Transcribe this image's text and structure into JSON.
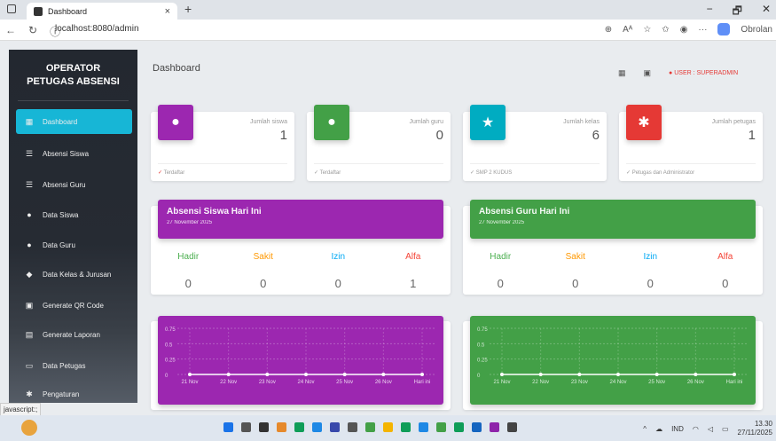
{
  "browser": {
    "tab_title": "Dashboard",
    "tab_close": "×",
    "new_tab": "+",
    "url": "localhost:8080/admin",
    "reader_label": "Aᴬ",
    "more": "···",
    "copilot_label": "Obrolan",
    "win_min": "−",
    "win_max": "🗗",
    "win_close": "✕"
  },
  "sidebar": {
    "title_line1": "OPERATOR",
    "title_line2": "PETUGAS ABSENSI",
    "items": [
      {
        "label": "Dashboard",
        "icon": "dashboard-icon",
        "glyph": "▦"
      },
      {
        "label": "Absensi Siswa",
        "icon": "checklist-icon",
        "glyph": "☰"
      },
      {
        "label": "Absensi Guru",
        "icon": "checklist-icon",
        "glyph": "☰"
      },
      {
        "label": "Data Siswa",
        "icon": "person-icon",
        "glyph": "●"
      },
      {
        "label": "Data Guru",
        "icon": "person-icon",
        "glyph": "●"
      },
      {
        "label": "Data Kelas & Jurusan",
        "icon": "school-icon",
        "glyph": "◆"
      },
      {
        "label": "Generate QR Code",
        "icon": "qr-icon",
        "glyph": "▣"
      },
      {
        "label": "Generate Laporan",
        "icon": "print-icon",
        "glyph": "▤"
      },
      {
        "label": "Data Petugas",
        "icon": "laptop-icon",
        "glyph": "▭"
      },
      {
        "label": "Pengaturan",
        "icon": "gear-icon",
        "glyph": "✱"
      }
    ]
  },
  "header": {
    "title": "Dashboard",
    "user_label": "USER : SUPERADMIN"
  },
  "stats": [
    {
      "label": "Jumlah siswa",
      "value": "1",
      "footer": "Terdaftar",
      "color": "#9c27b0",
      "icon": "person-icon",
      "glyph": "●",
      "foot_color": "#e53935"
    },
    {
      "label": "Jumlah guru",
      "value": "0",
      "footer": "Terdaftar",
      "color": "#43a047",
      "icon": "person-icon",
      "glyph": "●",
      "foot_color": "#999"
    },
    {
      "label": "Jumlah kelas",
      "value": "6",
      "footer": "SMP 2 KUDUS",
      "color": "#00acc1",
      "icon": "star-icon",
      "glyph": "★",
      "foot_color": "#999"
    },
    {
      "label": "Jumlah petugas",
      "value": "1",
      "footer": "Petugas dan Administrator",
      "color": "#e53935",
      "icon": "gear-icon",
      "glyph": "✱",
      "foot_color": "#999"
    }
  ],
  "attendance": [
    {
      "title": "Absensi Siswa Hari Ini",
      "date": "27 November 2025",
      "color": "#9c27b0",
      "labels": [
        "Hadir",
        "Sakit",
        "Izin",
        "Alfa"
      ],
      "values": [
        "0",
        "0",
        "0",
        "1"
      ]
    },
    {
      "title": "Absensi Guru Hari Ini",
      "date": "27 November 2025",
      "color": "#43a047",
      "labels": [
        "Hadir",
        "Sakit",
        "Izin",
        "Alfa"
      ],
      "values": [
        "0",
        "0",
        "0",
        "0"
      ]
    }
  ],
  "attendance_colors": [
    "#4caf50",
    "#ff9800",
    "#03a9f4",
    "#f44336"
  ],
  "chart_data": [
    {
      "type": "line",
      "x": [
        "21 Nov",
        "22 Nov",
        "23 Nov",
        "24 Nov",
        "25 Nov",
        "26 Nov",
        "Hari ini"
      ],
      "series": [
        {
          "values": [
            0,
            0,
            0,
            0,
            0,
            0,
            0
          ]
        }
      ],
      "yticks": [
        "0",
        "0.25",
        "0.5",
        "0.75"
      ],
      "ylim": [
        0,
        0.75
      ],
      "color": "#9c27b0"
    },
    {
      "type": "line",
      "x": [
        "21 Nov",
        "22 Nov",
        "23 Nov",
        "24 Nov",
        "25 Nov",
        "26 Nov",
        "Hari ini"
      ],
      "series": [
        {
          "values": [
            0,
            0,
            0,
            0,
            0,
            0,
            0
          ]
        }
      ],
      "yticks": [
        "0",
        "0.25",
        "0.5",
        "0.75"
      ],
      "ylim": [
        0,
        0.75
      ],
      "color": "#43a047"
    }
  ],
  "status_bar": "javascript:;",
  "taskbar": {
    "lang": "IND",
    "time": "13.30",
    "date": "27/11/2025"
  }
}
